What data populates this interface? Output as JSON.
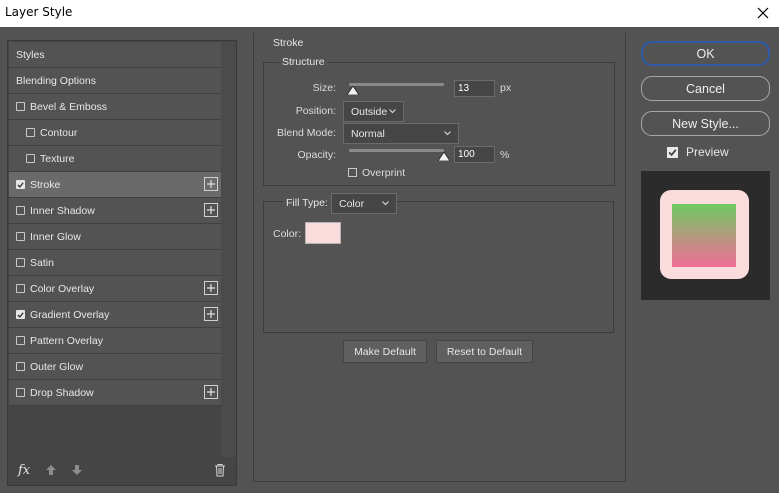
{
  "window": {
    "title": "Layer Style"
  },
  "styles": [
    {
      "label": "Styles",
      "kind": "header"
    },
    {
      "label": "Blending Options",
      "kind": "header"
    },
    {
      "label": "Bevel & Emboss",
      "checked": false,
      "plus": false
    },
    {
      "label": "Contour",
      "checked": false,
      "plus": false,
      "sub": true
    },
    {
      "label": "Texture",
      "checked": false,
      "plus": false,
      "sub": true
    },
    {
      "label": "Stroke",
      "checked": true,
      "plus": true,
      "selected": true
    },
    {
      "label": "Inner Shadow",
      "checked": false,
      "plus": true
    },
    {
      "label": "Inner Glow",
      "checked": false,
      "plus": false
    },
    {
      "label": "Satin",
      "checked": false,
      "plus": false
    },
    {
      "label": "Color Overlay",
      "checked": false,
      "plus": true
    },
    {
      "label": "Gradient Overlay",
      "checked": true,
      "plus": true
    },
    {
      "label": "Pattern Overlay",
      "checked": false,
      "plus": false
    },
    {
      "label": "Outer Glow",
      "checked": false,
      "plus": false
    },
    {
      "label": "Drop Shadow",
      "checked": false,
      "plus": true
    }
  ],
  "bottom_tools": {
    "fx_label": "fx"
  },
  "stroke": {
    "title": "Stroke",
    "structure_title": "Structure",
    "size_label": "Size:",
    "size_value": "13",
    "size_unit": "px",
    "size_level": 0.04,
    "position_label": "Position:",
    "position_value": "Outside",
    "blend_mode_label": "Blend Mode:",
    "blend_mode_value": "Normal",
    "opacity_label": "Opacity:",
    "opacity_value": "100",
    "opacity_unit": "%",
    "opacity_level": 1.0,
    "overprint_label": "Overprint",
    "overprint_checked": false,
    "fill_type_label": "Fill Type:",
    "fill_type_value": "Color",
    "color_label": "Color:",
    "color_value": "#fadcdc"
  },
  "buttons": {
    "make_default": "Make Default",
    "reset_to_default": "Reset to Default",
    "ok": "OK",
    "cancel": "Cancel",
    "new_style": "New Style..."
  },
  "preview": {
    "label": "Preview",
    "checked": true,
    "gradient_colors": [
      "#6ec95f",
      "#ef6e95"
    ],
    "stroke_color": "#fadcdc"
  }
}
